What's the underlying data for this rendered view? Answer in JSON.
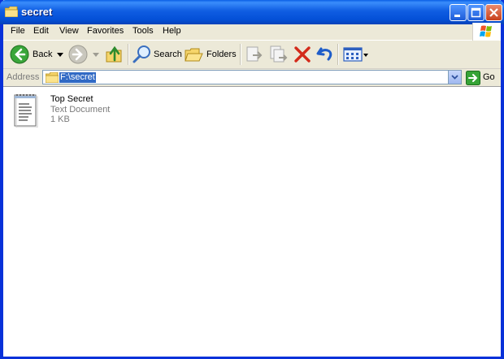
{
  "window": {
    "title": "secret"
  },
  "menu": {
    "items": [
      "File",
      "Edit",
      "View",
      "Favorites",
      "Tools",
      "Help"
    ]
  },
  "toolbar": {
    "back_label": "Back",
    "search_label": "Search",
    "folders_label": "Folders"
  },
  "address": {
    "label": "Address",
    "value": "F:\\secret",
    "go_label": "Go"
  },
  "files": [
    {
      "name": "Top Secret",
      "type": "Text Document",
      "size": "1 KB"
    }
  ],
  "colors": {
    "titlebar": "#0450d7",
    "selection": "#316ac5",
    "close_button": "#c8401c"
  }
}
